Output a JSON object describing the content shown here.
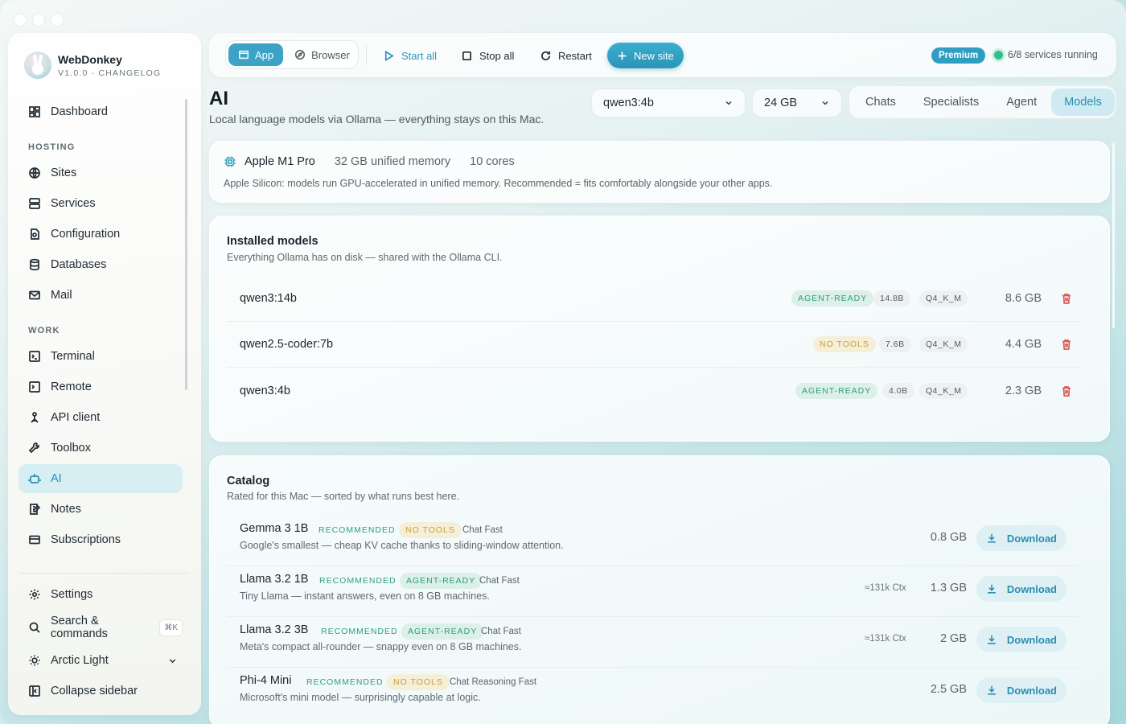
{
  "brand": {
    "name": "WebDonkey",
    "sub": "V1.0.0 · CHANGELOG"
  },
  "sidebar": {
    "top_items": [
      {
        "label": "Dashboard",
        "icon": "dashboard-icon"
      }
    ],
    "hosting_label": "HOSTING",
    "hosting": [
      {
        "label": "Sites",
        "icon": "globe-icon"
      },
      {
        "label": "Services",
        "icon": "server-icon"
      },
      {
        "label": "Configuration",
        "icon": "config-file-icon"
      },
      {
        "label": "Databases",
        "icon": "database-icon"
      },
      {
        "label": "Mail",
        "icon": "mail-icon"
      }
    ],
    "work_label": "WORK",
    "work": [
      {
        "label": "Terminal",
        "icon": "terminal-icon"
      },
      {
        "label": "Remote",
        "icon": "remote-terminal-icon"
      },
      {
        "label": "API client",
        "icon": "api-icon"
      },
      {
        "label": "Toolbox",
        "icon": "wrench-icon"
      },
      {
        "label": "AI",
        "icon": "robot-icon",
        "active": true
      },
      {
        "label": "Notes",
        "icon": "notes-icon"
      },
      {
        "label": "Subscriptions",
        "icon": "card-icon"
      }
    ],
    "bottom": {
      "settings": "Settings",
      "search": "Search & commands",
      "search_kbd": "⌘K",
      "theme": "Arctic Light",
      "collapse": "Collapse sidebar"
    }
  },
  "toolbar": {
    "app": "App",
    "browser": "Browser",
    "start_all": "Start all",
    "stop_all": "Stop all",
    "restart": "Restart",
    "new_site": "New site",
    "premium": "Premium",
    "status": "6/8 services running"
  },
  "header": {
    "title": "AI",
    "subtitle": "Local language models via Ollama — everything stays on this Mac.",
    "model_select": "qwen3:4b",
    "memory_select": "24 GB",
    "tabs": [
      "Chats",
      "Specialists",
      "Agent",
      "Models"
    ],
    "active_tab": "Models"
  },
  "hardware": {
    "chip": "Apple M1 Pro",
    "memory": "32 GB unified memory",
    "cores": "10 cores",
    "note": "Apple Silicon: models run GPU-accelerated in unified memory. Recommended = fits comfortably alongside your other apps."
  },
  "installed": {
    "title": "Installed models",
    "subtitle": "Everything Ollama has on disk — shared with the Ollama CLI.",
    "models": [
      {
        "name": "qwen3:14b",
        "status": "AGENT-READY",
        "status_color": "green",
        "params": "14.8B",
        "quant": "Q4_K_M",
        "size": "8.6 GB"
      },
      {
        "name": "qwen2.5-coder:7b",
        "status": "NO TOOLS",
        "status_color": "yellow",
        "params": "7.6B",
        "quant": "Q4_K_M",
        "size": "4.4 GB"
      },
      {
        "name": "qwen3:4b",
        "status": "AGENT-READY",
        "status_color": "green",
        "params": "4.0B",
        "quant": "Q4_K_M",
        "size": "2.3 GB"
      }
    ]
  },
  "catalog": {
    "title": "Catalog",
    "subtitle": "Rated for this Mac — sorted by what runs best here.",
    "download_label": "Download",
    "items": [
      {
        "name": "Gemma 3 1B",
        "rec": "RECOMMENDED",
        "status": "NO TOOLS",
        "status_color": "yellow",
        "tags": "Chat  Fast",
        "desc": "Google's smallest — cheap KV cache thanks to sliding-window attention.",
        "ctx": "",
        "size": "0.8 GB"
      },
      {
        "name": "Llama 3.2 1B",
        "rec": "RECOMMENDED",
        "status": "AGENT-READY",
        "status_color": "green",
        "tags": "Chat  Fast",
        "desc": "Tiny Llama — instant answers, even on 8 GB machines.",
        "ctx": "≈131k Ctx",
        "size": "1.3 GB"
      },
      {
        "name": "Llama 3.2 3B",
        "rec": "RECOMMENDED",
        "status": "AGENT-READY",
        "status_color": "green",
        "tags": "Chat  Fast",
        "desc": "Meta's compact all-rounder — snappy even on 8 GB machines.",
        "ctx": "≈131k Ctx",
        "size": "2 GB"
      },
      {
        "name": "Phi-4 Mini",
        "rec": "RECOMMENDED",
        "status": "NO TOOLS",
        "status_color": "yellow",
        "tags": "Chat  Reasoning  Fast",
        "desc": "Microsoft's mini model — surprisingly capable at logic.",
        "ctx": "",
        "size": "2.5 GB"
      }
    ]
  }
}
